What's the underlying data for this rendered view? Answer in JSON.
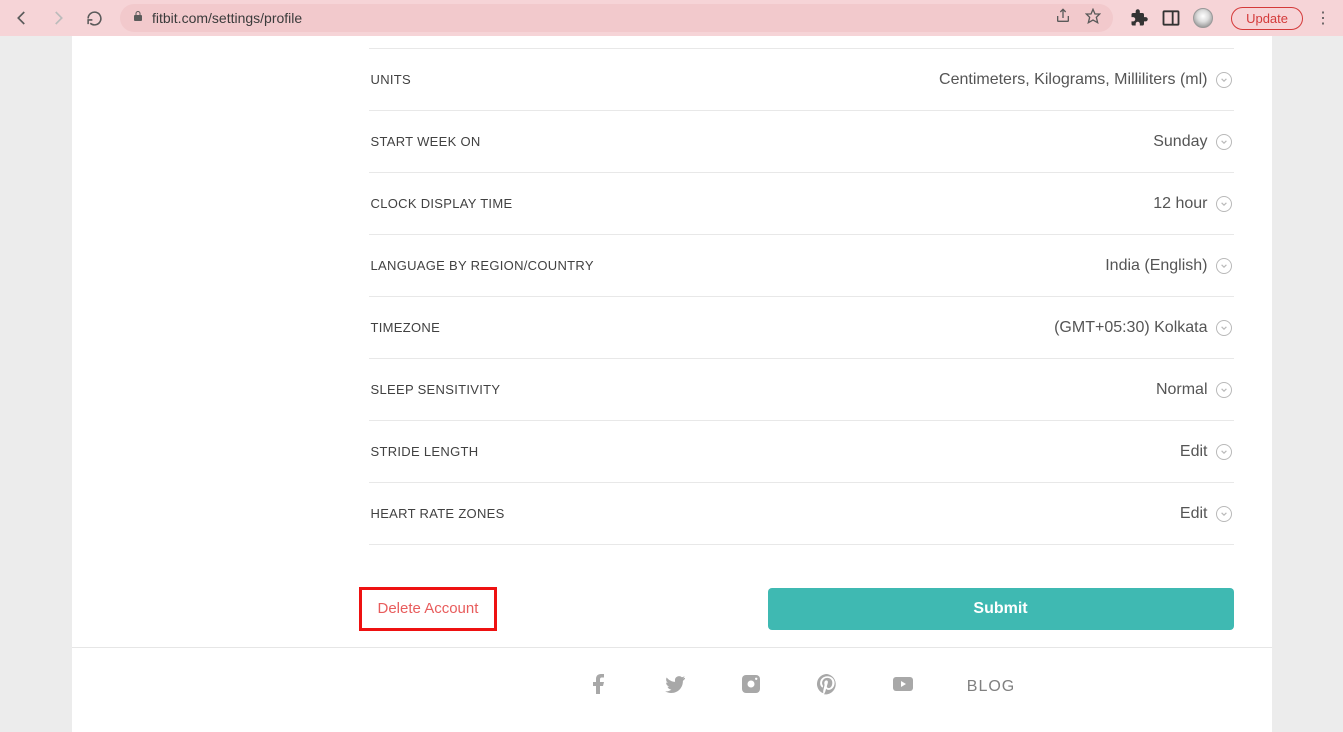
{
  "browser": {
    "url": "fitbit.com/settings/profile",
    "update_label": "Update"
  },
  "settings": {
    "rows": [
      {
        "label": "UNITS",
        "value": "Centimeters, Kilograms, Milliliters (ml)"
      },
      {
        "label": "START WEEK ON",
        "value": "Sunday"
      },
      {
        "label": "CLOCK DISPLAY TIME",
        "value": "12 hour"
      },
      {
        "label": "LANGUAGE BY REGION/COUNTRY",
        "value": "India (English)"
      },
      {
        "label": "TIMEZONE",
        "value": "(GMT+05:30) Kolkata"
      },
      {
        "label": "SLEEP SENSITIVITY",
        "value": "Normal"
      },
      {
        "label": "STRIDE LENGTH",
        "value": "Edit"
      },
      {
        "label": "HEART RATE ZONES",
        "value": "Edit"
      }
    ],
    "delete_label": "Delete Account",
    "submit_label": "Submit"
  },
  "footer": {
    "blog_label": "BLOG"
  }
}
